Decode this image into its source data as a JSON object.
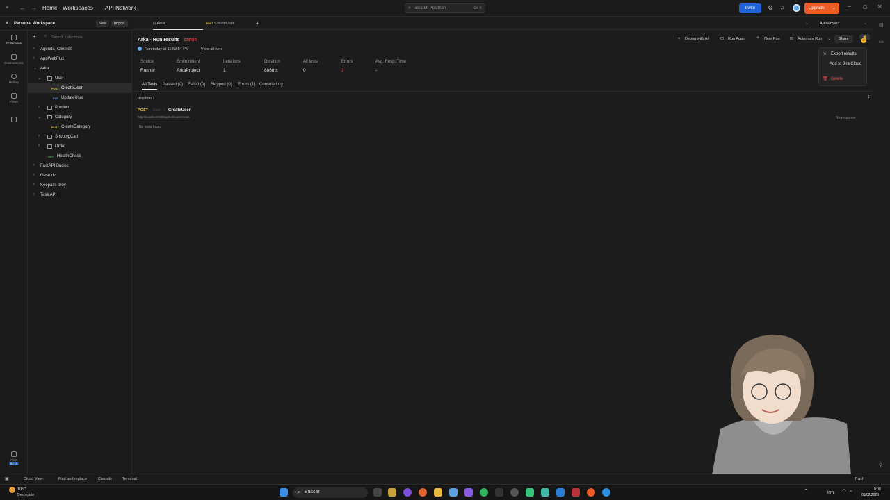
{
  "topbar": {
    "nav": [
      "Home",
      "Workspaces",
      "API Network"
    ],
    "search_placeholder": "Search Postman",
    "search_shortcut": "Ctrl K",
    "invite": "Invite",
    "upgrade": "Upgrade",
    "environment": "ArkaProject"
  },
  "workspace": {
    "name": "Personal Workspace",
    "new": "New",
    "import": "Import",
    "search_placeholder": "Search collections"
  },
  "rail": [
    "Collections",
    "Environments",
    "History",
    "Flows",
    "Files",
    "BETA"
  ],
  "tree": [
    {
      "label": "Agenda_Clientes"
    },
    {
      "label": "AppWebFlux"
    },
    {
      "label": "Arka"
    },
    {
      "label": "User"
    },
    {
      "label": "CreateUser",
      "method": "POST"
    },
    {
      "label": "UpdateUser",
      "method": "PUT"
    },
    {
      "label": "Product"
    },
    {
      "label": "Category"
    },
    {
      "label": "CreateCategory",
      "method": "POST"
    },
    {
      "label": "ShopingCart"
    },
    {
      "label": "Order"
    },
    {
      "label": "HealthCheck",
      "method": "GET"
    },
    {
      "label": "FastAPI Bacisc"
    },
    {
      "label": "Gestoriz"
    },
    {
      "label": "Keepass proy"
    },
    {
      "label": "Task API"
    }
  ],
  "tabs": [
    {
      "label": "Arka"
    },
    {
      "method": "POST",
      "label": "CreateUser"
    }
  ],
  "run": {
    "title": "Arka - Run results",
    "status": "ERROR",
    "ran_text": "Ran today at 11:59:54 PM",
    "view_all": "View all runs",
    "actions": [
      "Debug with AI",
      "Run Again",
      "New Run",
      "Automate Run",
      "Share"
    ],
    "stats": [
      {
        "label": "Source",
        "value": "Runner"
      },
      {
        "label": "Environment",
        "value": "ArkaProject"
      },
      {
        "label": "Iterations",
        "value": "1"
      },
      {
        "label": "Duration",
        "value": "806ms"
      },
      {
        "label": "All tests",
        "value": "0"
      },
      {
        "label": "Errors",
        "value": "1"
      },
      {
        "label": "Avg. Resp. Time",
        "value": "-"
      }
    ],
    "subtabs": [
      "All Tests",
      "Passed (0)",
      "Failed (0)",
      "Skipped (0)",
      "Errors (1)",
      "Console Log"
    ],
    "iteration": "Iteration 1",
    "request": {
      "method": "POST",
      "folder": "User",
      "name": "CreateUser",
      "url": "http://localhost:900/api/v0/user/create",
      "no_tests": "No tests found",
      "response": "No response"
    },
    "page_indicator": "1"
  },
  "menu": [
    "Export results",
    "Add to Jira Cloud",
    "Delete"
  ],
  "statusbar": [
    "Cloud View",
    "Find and replace",
    "Console",
    "Terminal",
    "Trash"
  ],
  "taskbar": {
    "search": "Buscar",
    "weather_temp": "10°C",
    "weather_desc": "Despejado",
    "lang": "INTL",
    "time": "0:00",
    "date": "05/02/2026"
  },
  "colors": {
    "post": "#e8c547",
    "put": "#5d8ed8",
    "get": "#4caf50",
    "error": "#e5484d",
    "accent": "#ef5b25",
    "invite": "#1f63d6"
  }
}
